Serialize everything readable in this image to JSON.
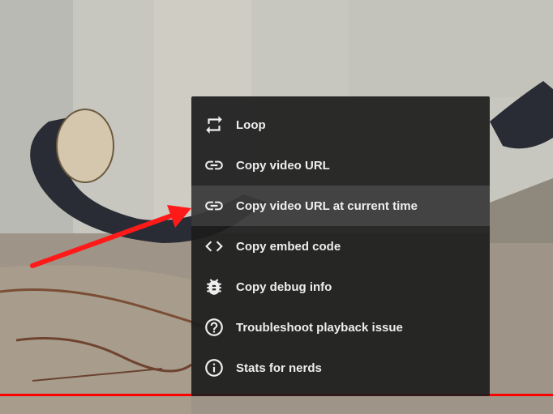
{
  "menu": {
    "items": [
      {
        "label": "Loop",
        "icon": "loop-icon"
      },
      {
        "label": "Copy video URL",
        "icon": "link-icon"
      },
      {
        "label": "Copy video URL at current time",
        "icon": "link-icon"
      },
      {
        "label": "Copy embed code",
        "icon": "code-icon"
      },
      {
        "label": "Copy debug info",
        "icon": "bug-icon"
      },
      {
        "label": "Troubleshoot playback issue",
        "icon": "help-circle-icon"
      },
      {
        "label": "Stats for nerds",
        "icon": "info-circle-icon"
      }
    ],
    "highlighted_index": 2
  },
  "colors": {
    "menu_background": "#1c1c1c",
    "menu_text": "#eeeeee",
    "progress": "#ff0000",
    "arrow": "#ff1a1a"
  }
}
